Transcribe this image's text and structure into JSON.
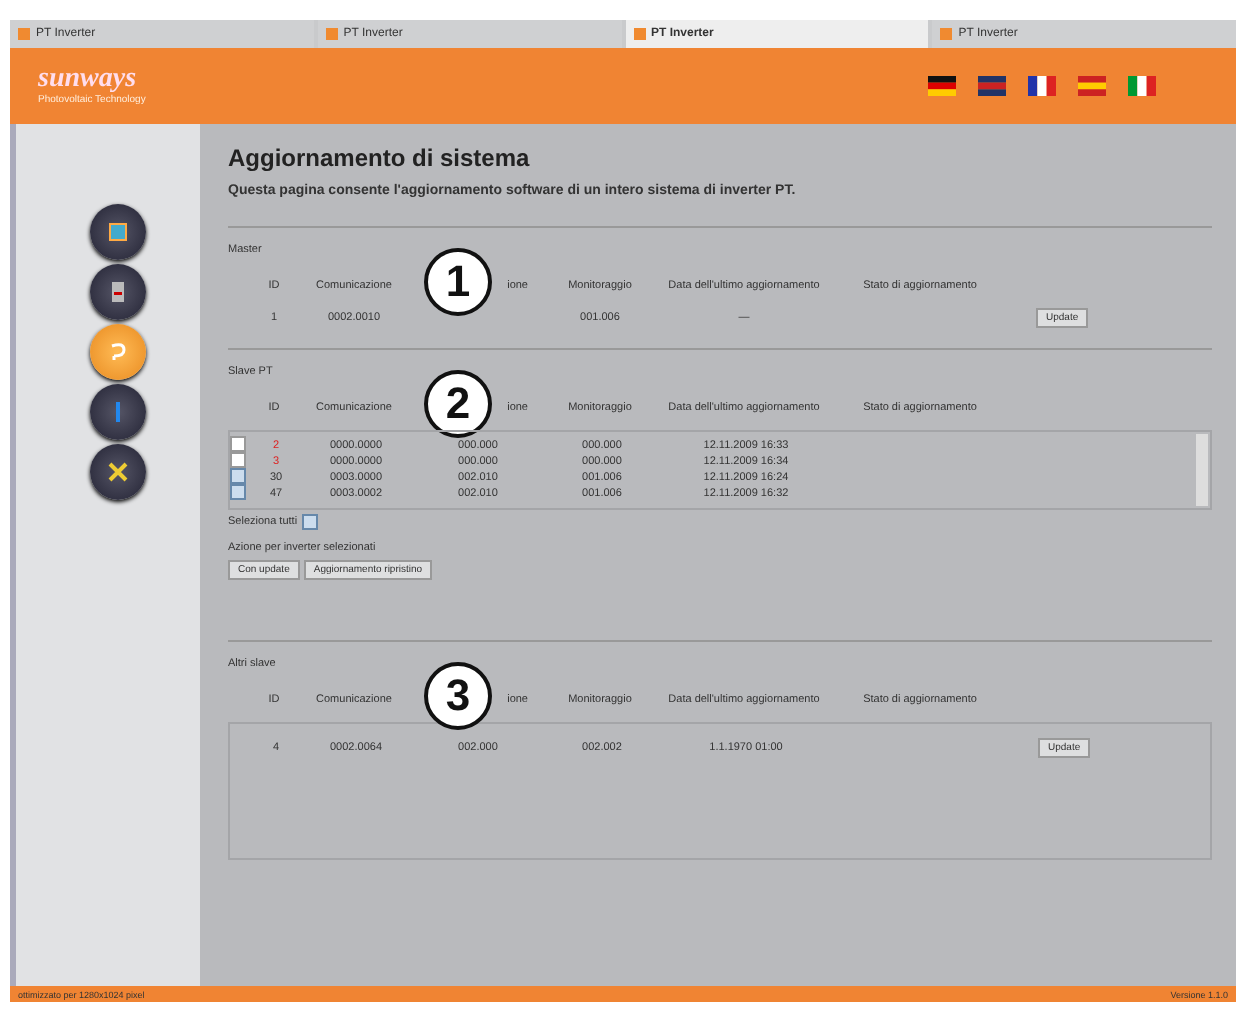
{
  "browser_tabs": [
    {
      "title": "PT Inverter",
      "selected": false
    },
    {
      "title": "PT Inverter",
      "selected": false
    },
    {
      "title": "PT Inverter",
      "selected": true
    },
    {
      "title": "PT Inverter",
      "selected": false
    }
  ],
  "header": {
    "logo": "sunways",
    "tagline": "Photovoltaic Technology",
    "flags": [
      {
        "kind": "de"
      },
      {
        "kind": "uk"
      },
      {
        "kind": "fr"
      },
      {
        "kind": "es"
      },
      {
        "kind": "it"
      }
    ]
  },
  "sidebar": {
    "items": [
      {
        "kind": "chart",
        "selected": false
      },
      {
        "kind": "device",
        "selected": false
      },
      {
        "kind": "update",
        "selected": true
      },
      {
        "kind": "info",
        "selected": false
      },
      {
        "kind": "tools",
        "selected": false
      }
    ]
  },
  "page": {
    "title": "Aggiornamento di sistema",
    "description": "Questa pagina consente l'aggiornamento software di un intero sistema di inverter PT."
  },
  "master": {
    "label": "Master",
    "callout": "1",
    "columns": [
      "ID",
      "Comunicazione",
      "ione",
      "Monitoraggio",
      "Data dell'ultimo aggiornamento",
      "Stato di aggiornamento"
    ],
    "rows": [
      {
        "id": "1",
        "id_red": false,
        "comm": "0002.0010",
        "mon": "001.006",
        "date": "—",
        "button": "Update"
      }
    ]
  },
  "slaves": {
    "label": "Slave PT",
    "callout": "2",
    "columns": [
      "ID",
      "Comunicazione",
      "ione",
      "Monitoraggio",
      "Data dell'ultimo aggiornamento",
      "Stato di aggiornamento"
    ],
    "rows": [
      {
        "checked": false,
        "id": "2",
        "id_red": true,
        "comm": "0000.0000",
        "app": "000.000",
        "mon": "000.000",
        "date": "12.11.2009 16:33"
      },
      {
        "checked": false,
        "id": "3",
        "id_red": true,
        "comm": "0000.0000",
        "app": "000.000",
        "mon": "000.000",
        "date": "12.11.2009 16:34"
      },
      {
        "checked": true,
        "id": "30",
        "id_red": false,
        "comm": "0003.0000",
        "app": "002.010",
        "mon": "001.006",
        "date": "12.11.2009 16:24"
      },
      {
        "checked": true,
        "id": "47",
        "id_red": false,
        "comm": "0003.0002",
        "app": "002.010",
        "mon": "001.006",
        "date": "12.11.2009 16:32"
      }
    ],
    "select_all": {
      "label": "Seleziona tutti",
      "checked": true
    },
    "actions_label": "Azione per inverter selezionati",
    "actions": [
      "Con update",
      "Aggiornamento ripristino"
    ]
  },
  "others": {
    "label": "Altri slave",
    "callout": "3",
    "columns": [
      "ID",
      "Comunicazione",
      "ione",
      "Monitoraggio",
      "Data dell'ultimo aggiornamento",
      "Stato di aggiornamento"
    ],
    "rows": [
      {
        "id": "4",
        "id_red": false,
        "comm": "0002.0064",
        "app": "002.000",
        "mon": "002.002",
        "date": "1.1.1970 01:00",
        "button": "Update"
      }
    ]
  },
  "footer": {
    "left": "ottimizzato per 1280x1024 pixel",
    "right": "Versione 1.1.0"
  }
}
